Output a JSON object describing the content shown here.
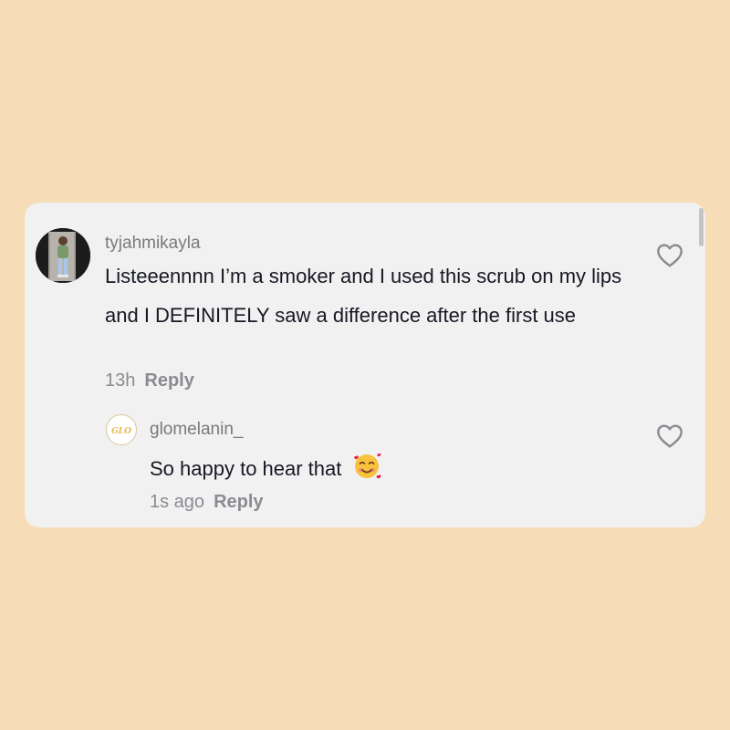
{
  "comments": [
    {
      "username": "tyjahmikayla",
      "text": "Listeeennnn I’m a smoker and I used this scrub on my lips and I DEFINITELY saw a difference after the first use",
      "time": "13h",
      "reply_label": "Reply",
      "like_icon": "heart-outline-icon"
    }
  ],
  "replies": [
    {
      "username": "glomelanin_",
      "text": "So happy to hear that",
      "emoji": "smiling-face-with-hearts-icon",
      "time": "1s ago",
      "reply_label": "Reply",
      "like_icon": "heart-outline-icon",
      "avatar_logo": "GLO"
    }
  ],
  "colors": {
    "page_background": "#f7dcb8",
    "card_background": "#f1f1f2",
    "text_primary": "#161823",
    "text_secondary": "#8a8b91",
    "glo_logo": "#e7b84a"
  }
}
